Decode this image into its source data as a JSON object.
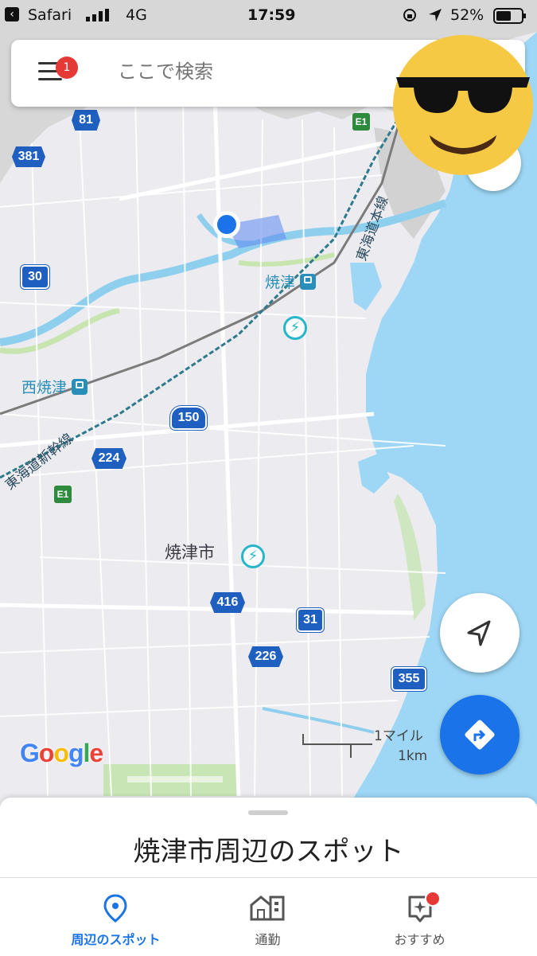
{
  "status_bar": {
    "back_label": "Safari",
    "network": "4G",
    "time": "17:59",
    "battery": "52%"
  },
  "search": {
    "placeholder": "ここで検索",
    "menu_badge": "1"
  },
  "map": {
    "stations": [
      {
        "label": "焼津"
      },
      {
        "label": "西焼津"
      }
    ],
    "city_label": "焼津市",
    "rail_labels": [
      "東海道本線",
      "東海道新幹線"
    ],
    "route_shields": [
      "81",
      "381",
      "30",
      "150",
      "224",
      "416",
      "31",
      "226",
      "355"
    ],
    "expressway_shields": [
      "E1",
      "E1"
    ],
    "scale": {
      "imperial": "1マイル",
      "metric": "1km"
    },
    "attribution": "Google"
  },
  "bottom_sheet": {
    "title": "焼津市周辺のスポット"
  },
  "bottom_nav": {
    "items": [
      {
        "label": "周辺のスポット",
        "icon": "location-pin-icon",
        "active": true
      },
      {
        "label": "通勤",
        "icon": "commute-buildings-icon",
        "active": false
      },
      {
        "label": "おすすめ",
        "icon": "recommendations-sparkle-icon",
        "active": false
      }
    ]
  },
  "colors": {
    "accent": "#1a73e8",
    "water": "#9dd7f5",
    "land": "#eceaf0",
    "badge": "#e53935"
  }
}
